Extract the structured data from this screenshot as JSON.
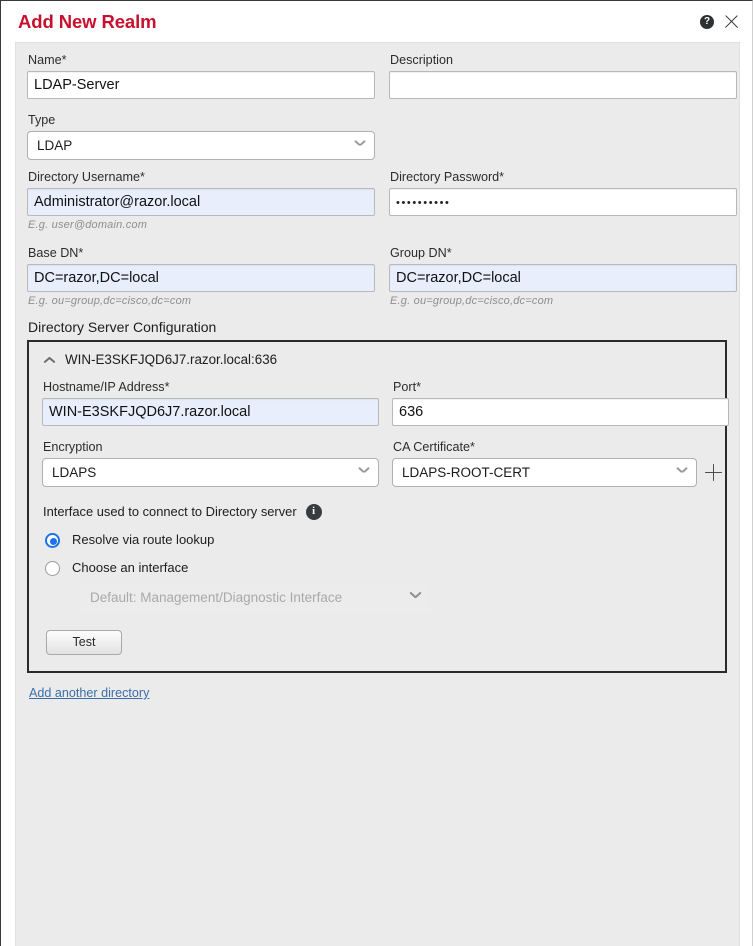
{
  "dialog": {
    "title": "Add New Realm",
    "help_icon": "help-circle-icon",
    "close_icon": "close-icon"
  },
  "form": {
    "name": {
      "label": "Name*",
      "value": "LDAP-Server"
    },
    "description": {
      "label": "Description",
      "value": ""
    },
    "type": {
      "label": "Type",
      "value": "LDAP"
    },
    "directory_username": {
      "label": "Directory Username*",
      "value": "Administrator@razor.local",
      "hint": "E.g. user@domain.com"
    },
    "directory_password": {
      "label": "Directory Password*",
      "value": "••••••••••"
    },
    "base_dn": {
      "label": "Base DN*",
      "value": "DC=razor,DC=local",
      "hint": "E.g. ou=group,dc=cisco,dc=com"
    },
    "group_dn": {
      "label": "Group DN*",
      "value": "DC=razor,DC=local",
      "hint": "E.g. ou=group,dc=cisco,dc=com"
    }
  },
  "directory_server": {
    "section_title": "Directory Server Configuration",
    "panel_header": "WIN-E3SKFJQD6J7.razor.local:636",
    "collapse_icon": "chevron-up-icon",
    "hostname": {
      "label": "Hostname/IP Address*",
      "value": "WIN-E3SKFJQD6J7.razor.local"
    },
    "port": {
      "label": "Port*",
      "value": "636"
    },
    "encryption": {
      "label": "Encryption",
      "value": "LDAPS"
    },
    "ca_certificate": {
      "label": "CA Certificate*",
      "value": "LDAPS-ROOT-CERT",
      "add_icon": "plus-icon"
    },
    "interface": {
      "label": "Interface used to connect to Directory server",
      "info_icon": "info-circle-icon",
      "options": [
        {
          "label": "Resolve via route lookup",
          "selected": true
        },
        {
          "label": "Choose an interface",
          "selected": false
        }
      ],
      "interface_select_value": "Default: Management/Diagnostic Interface"
    },
    "test_button": "Test"
  },
  "add_another_directory": "Add another directory",
  "colors": {
    "title_red": "#c8102e",
    "panel_bg": "#ebebeb",
    "autofill_blue": "#e8eefc",
    "radio_blue": "#1a73e8",
    "link_blue": "#3c6ea8"
  }
}
